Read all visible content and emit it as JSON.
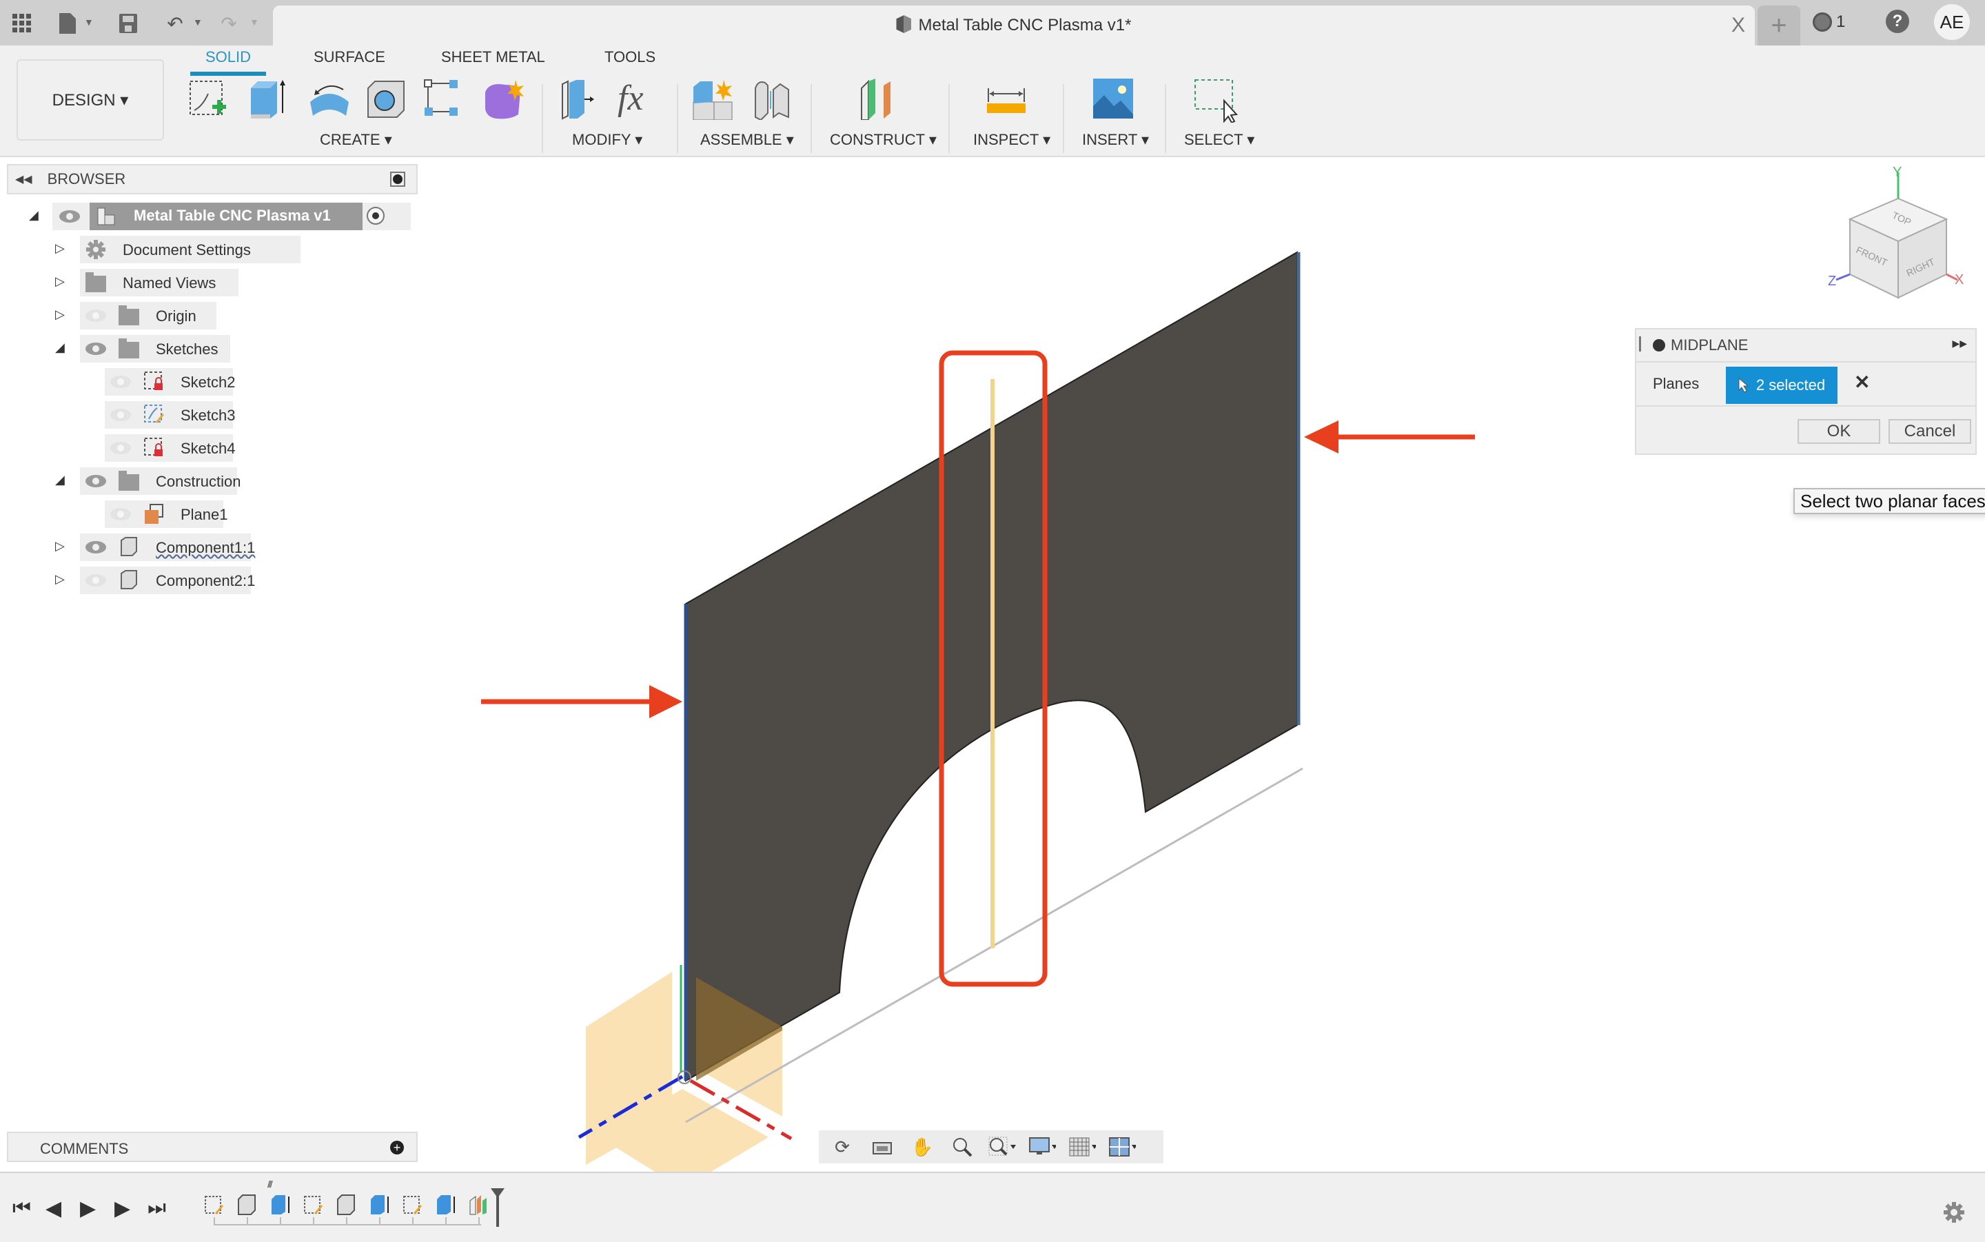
{
  "titlebar": {
    "document_title": "Metal Table CNC Plasma v1*",
    "jobs_count": "1",
    "help_label": "?",
    "user_initials": "AE",
    "close_tab_label": "X",
    "new_tab_label": "+"
  },
  "toolbar": {
    "workspace_label": "DESIGN ▾",
    "tabs": [
      {
        "label": "SOLID",
        "active": true
      },
      {
        "label": "SURFACE",
        "active": false
      },
      {
        "label": "SHEET METAL",
        "active": false
      },
      {
        "label": "TOOLS",
        "active": false
      }
    ],
    "groups": [
      {
        "label": "CREATE ▾",
        "icons": [
          "create-sketch-icon",
          "extrude-icon",
          "revolve-icon",
          "hole-icon",
          "pattern-icon",
          "create-form-icon"
        ]
      },
      {
        "label": "MODIFY ▾",
        "icons": [
          "press-pull-icon",
          "parameters-fx-icon"
        ]
      },
      {
        "label": "ASSEMBLE ▾",
        "icons": [
          "new-component-icon",
          "joint-icon"
        ]
      },
      {
        "label": "CONSTRUCT ▾",
        "icons": [
          "offset-plane-icon"
        ]
      },
      {
        "label": "INSPECT ▾",
        "icons": [
          "measure-icon"
        ]
      },
      {
        "label": "INSERT ▾",
        "icons": [
          "insert-image-icon"
        ]
      },
      {
        "label": "SELECT ▾",
        "icons": [
          "window-select-icon"
        ]
      }
    ],
    "fx_label": "fx"
  },
  "browser": {
    "title": "BROWSER",
    "root": "Metal Table CNC Plasma v1",
    "items": [
      {
        "label": "Document Settings",
        "icon": "gear-icon",
        "expanded": false,
        "visible": null
      },
      {
        "label": "Named Views",
        "icon": "folder-icon",
        "expanded": false,
        "visible": null
      },
      {
        "label": "Origin",
        "icon": "folder-icon",
        "expanded": false,
        "visible": false
      },
      {
        "label": "Sketches",
        "icon": "folder-icon",
        "expanded": true,
        "visible": true
      },
      {
        "label": "Sketch2",
        "icon": "sketch-locked-icon",
        "visible": false
      },
      {
        "label": "Sketch3",
        "icon": "sketch-edit-icon",
        "visible": false
      },
      {
        "label": "Sketch4",
        "icon": "sketch-locked-icon",
        "visible": false
      },
      {
        "label": "Construction",
        "icon": "folder-icon",
        "expanded": true,
        "visible": true
      },
      {
        "label": "Plane1",
        "icon": "plane-icon",
        "visible": false
      },
      {
        "label": "Component1:1",
        "icon": "component-icon",
        "expanded": false,
        "visible": true
      },
      {
        "label": "Component2:1",
        "icon": "component-icon",
        "expanded": false,
        "visible": false
      }
    ]
  },
  "comments": {
    "title": "COMMENTS"
  },
  "viewcube": {
    "faces": [
      "TOP",
      "FRONT",
      "RIGHT"
    ],
    "axes": [
      "X",
      "Y",
      "Z"
    ]
  },
  "midplane_dialog": {
    "title": "MIDPLANE",
    "field_label": "Planes",
    "selection_label": "2 selected",
    "clear_label": "✕",
    "ok_label": "OK",
    "cancel_label": "Cancel"
  },
  "tooltip": {
    "text": "Select two planar faces"
  },
  "colors": {
    "accent": "#1f8dbc",
    "selection": "#1590d4",
    "annotation_red": "#e8401f",
    "body": "#4e4a45",
    "construction_plane": "#f8d9a0"
  },
  "timeline": {
    "controls": [
      "go-to-start",
      "step-back",
      "play",
      "step-forward",
      "go-to-end"
    ],
    "features": [
      "sketch",
      "body",
      "extrude",
      "sketch",
      "body",
      "extrude",
      "sketch",
      "extrude",
      "midplane"
    ]
  }
}
